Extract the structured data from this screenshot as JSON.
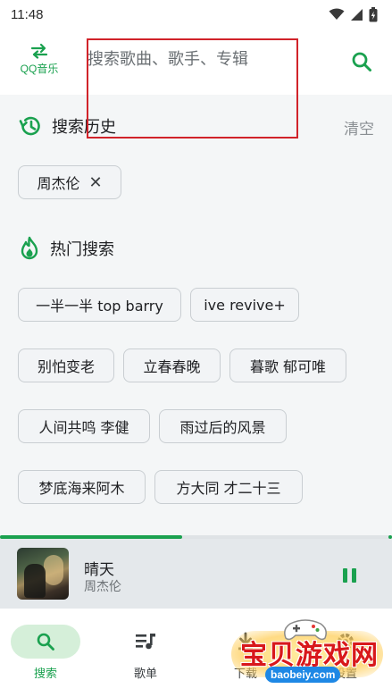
{
  "status_bar": {
    "time": "11:48",
    "icons": [
      "wifi-icon",
      "signal-icon",
      "battery-charging-icon"
    ]
  },
  "header": {
    "source_switch": {
      "icon": "swap-arrows-icon",
      "label": "QQ音乐"
    },
    "search": {
      "placeholder": "搜索歌曲、歌手、专辑",
      "value": ""
    },
    "search_button_icon": "search-icon"
  },
  "history": {
    "icon": "history-clock-icon",
    "title": "搜索历史",
    "clear_label": "清空",
    "items": [
      {
        "label": "周杰伦",
        "remove_icon": "close-icon",
        "remove_glyph": "✕"
      }
    ]
  },
  "hot": {
    "icon": "flame-icon",
    "title": "热门搜索",
    "items": [
      "一半一半 top barry",
      "ive revive+",
      "别怕变老",
      "立春春晚",
      "暮歌 郁可唯",
      "人间共鸣 李健",
      "雨过后的风景",
      "梦底海来阿木",
      "方大同 才二十三"
    ]
  },
  "player": {
    "progress": 0.465,
    "song_title": "晴天",
    "artist": "周杰伦",
    "pause_icon": "pause-icon",
    "album_art": "album-art"
  },
  "nav": {
    "items": [
      {
        "label": "搜索",
        "icon": "search-icon",
        "active": true
      },
      {
        "label": "歌单",
        "icon": "playlist-icon",
        "active": false
      },
      {
        "label": "下载",
        "icon": "download-icon",
        "active": false
      },
      {
        "label": "设置",
        "icon": "settings-icon",
        "active": false
      }
    ]
  },
  "watermark": {
    "title": "宝贝游戏网",
    "domain": "baobeiy.com"
  },
  "colors": {
    "accent": "#1aa14f",
    "focus_box": "#d1232a",
    "player_bg": "#e4e8eb",
    "page_bg": "#f4f6f7"
  }
}
